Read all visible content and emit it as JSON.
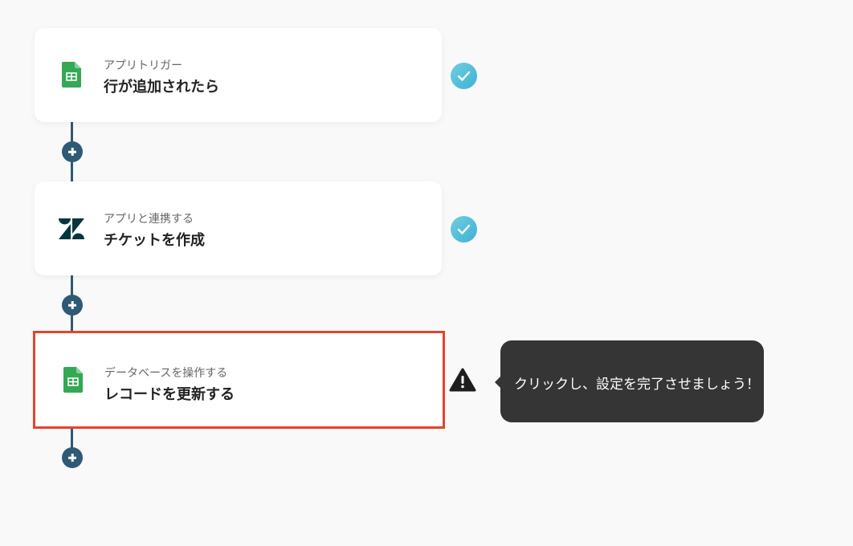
{
  "flow": {
    "steps": [
      {
        "category": "アプリトリガー",
        "title": "行が追加されたら",
        "app_icon": "google-sheets-icon",
        "status": "completed"
      },
      {
        "category": "アプリと連携する",
        "title": "チケットを作成",
        "app_icon": "zendesk-icon",
        "status": "completed"
      },
      {
        "category": "データベースを操作する",
        "title": "レコードを更新する",
        "app_icon": "google-sheets-icon",
        "status": "incomplete"
      }
    ]
  },
  "tooltip": {
    "text": "クリックし、設定を完了させましょう！"
  },
  "colors": {
    "background": "#f9f9f9",
    "connector": "#2f5a75",
    "selected_border": "#e4432d",
    "check_start": "#6ed0dc",
    "check_end": "#3fb0d8",
    "sheets_green": "#34a853",
    "tooltip_bg": "#353535"
  }
}
